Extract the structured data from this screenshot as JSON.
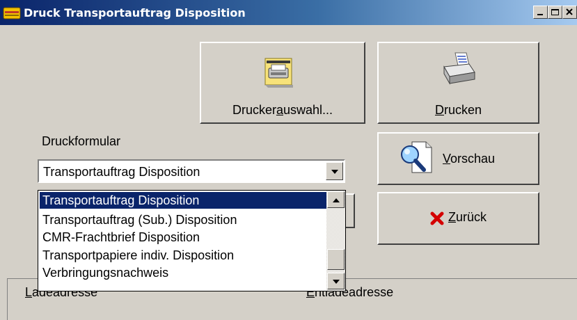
{
  "window": {
    "title": "Druck Transportauftrag Disposition"
  },
  "buttons": {
    "drucker_auswahl": {
      "pre": "Drucker",
      "mn": "a",
      "post": "uswahl..."
    },
    "drucken": {
      "pre": "",
      "mn": "D",
      "post": "rucken"
    },
    "vorschau": {
      "pre": "",
      "mn": "V",
      "post": "orschau"
    },
    "zurueck": {
      "pre": "",
      "mn": "Z",
      "post": "urück"
    }
  },
  "form": {
    "druckformular_label": "Druckformular",
    "selected": "Transportauftrag Disposition",
    "options": [
      "Transportauftrag Disposition",
      "Transportauftrag (Sub.) Disposition",
      "CMR-Frachtbrief Disposition",
      "Transportpapiere indiv. Disposition",
      "Verbringungsnachweis"
    ]
  },
  "tabs": {
    "ladeadresse": {
      "mn": "L",
      "rest": "adeadresse"
    },
    "entladeadresse": {
      "mn": "E",
      "rest": "ntladeadresse"
    }
  },
  "icons": [
    "app-icon",
    "printer-select-icon",
    "printer-icon",
    "preview-magnifier-icon",
    "cancel-x-icon"
  ],
  "colors": {
    "selection": "#0a246a",
    "cancel": "#d40000",
    "face": "#d4d0c8"
  }
}
